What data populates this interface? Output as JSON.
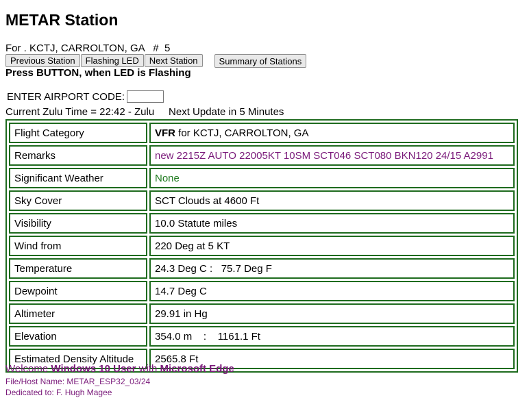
{
  "page_title": "METAR Station",
  "station_line": "For . KCTJ, CARROLTON, GA   #  5",
  "buttons": {
    "previous": "Previous Station",
    "flashing": "Flashing LED",
    "next": "Next Station",
    "summary": "Summary of Stations"
  },
  "press_text": "Press BUTTON, when LED is Flashing",
  "airport_code_label": "ENTER AIRPORT CODE:",
  "airport_code_value": "",
  "zulu_line": "Current Zulu Time = 22:42 - Zulu     Next Update in 5 Minutes",
  "rows": [
    {
      "label": "Flight Category",
      "value_bold": "VFR",
      "value": " for KCTJ, CARROLTON, GA"
    },
    {
      "label": "Remarks",
      "value": "new 2215Z AUTO 22005KT 10SM SCT046 SCT080 BKN120 24/15 A2991"
    },
    {
      "label": "Significant Weather",
      "value": "None"
    },
    {
      "label": "Sky Cover",
      "value": "SCT Clouds at 4600 Ft"
    },
    {
      "label": "Visibility",
      "value": "10.0 Statute miles"
    },
    {
      "label": "Wind from",
      "value": "220 Deg at 5 KT"
    },
    {
      "label": "Temperature",
      "value": "24.3 Deg C :   75.7 Deg F"
    },
    {
      "label": "Dewpoint",
      "value": "14.7 Deg C"
    },
    {
      "label": "Altimeter",
      "value": "29.91 in Hg"
    },
    {
      "label": "Elevation",
      "value": "354.0 m    :    1161.1 Ft"
    },
    {
      "label": "Estimated Density Altitude",
      "value": "2565.8 Ft"
    }
  ],
  "welcome": {
    "prefix": "Welcome ",
    "os": "Windows 10 User",
    "mid": " with ",
    "browser": "Microsoft Edge"
  },
  "file_host": "File/Host Name: METAR_ESP32_03/24",
  "dedicated": "Dedicated to: F. Hugh Magee",
  "colors": {
    "border_green": "#1e6b1e",
    "purple": "#7a1a7a",
    "green_text": "#1e7a1e"
  }
}
